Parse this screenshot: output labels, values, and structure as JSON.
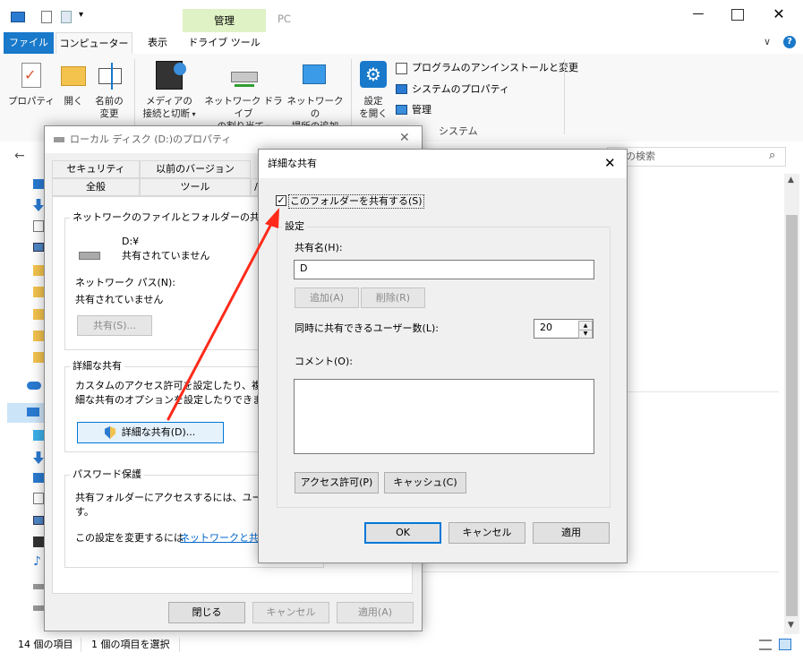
{
  "explorer": {
    "title": "PC",
    "context_tab_group": "管理",
    "tabs": [
      "ファイル",
      "コンピューター",
      "表示",
      "ドライブ ツール"
    ],
    "ribbon": {
      "properties": "プロパティ",
      "open": "開く",
      "rename": [
        "名前の",
        "変更"
      ],
      "media": [
        "メディアの",
        "接続と切断"
      ],
      "map_drive": [
        "ネットワーク ドライブ",
        "の割り当て"
      ],
      "add_location": [
        "ネットワークの",
        "場所の追加"
      ],
      "open_settings": [
        "設定",
        "を開く"
      ],
      "uninstall": "プログラムのアンインストールと変更",
      "sys_props": "システムのプロパティ",
      "manage": "管理",
      "group_system": "システム"
    },
    "search_placeholder": "の検索",
    "status_items": "14 個の項目",
    "status_selected": "1 個の項目を選択"
  },
  "props_dialog": {
    "title": "ローカル ディスク (D:)のプロパティ",
    "tabs_row1": [
      "セキュリティ",
      "以前のバージョン"
    ],
    "tabs_row2": [
      "全般",
      "ツール"
    ],
    "net_share_group": "ネットワークのファイルとフォルダーの共有",
    "drive_name": "D:¥",
    "drive_status": "共有されていません",
    "net_path_label": "ネットワーク パス(N):",
    "net_path_value": "共有されていません",
    "share_button": "共有(S)...",
    "adv_group": "詳細な共有",
    "adv_desc_1": "カスタムのアクセス許可を設定したり、複数の",
    "adv_desc_2": "細な共有のオプションを設定したりできます。",
    "adv_button": "詳細な共有(D)...",
    "pw_group": "パスワード保護",
    "pw_desc_1": "共有フォルダーにアクセスするには、ユーザー ア",
    "pw_desc_2": "す。",
    "pw_change": "この設定を変更するには",
    "pw_link": "ネットワークと共有",
    "close": "閉じる",
    "cancel": "キャンセル",
    "apply": "適用(A)"
  },
  "adv_dialog": {
    "title": "詳細な共有",
    "share_checkbox": "このフォルダーを共有する(S)",
    "checked": true,
    "settings_group": "設定",
    "share_name_label": "共有名(H):",
    "share_name_value": "D",
    "add": "追加(A)",
    "remove": "削除(R)",
    "users_label": "同時に共有できるユーザー数(L):",
    "users_value": "20",
    "comment_label": "コメント(O):",
    "comment_value": "",
    "permissions": "アクセス許可(P)",
    "caching": "キャッシュ(C)",
    "ok": "OK",
    "cancel": "キャンセル",
    "apply": "適用"
  },
  "colors": {
    "accent": "#1979ca",
    "arrow": "#ff2a1a",
    "context_tab": "#dff2c5"
  }
}
